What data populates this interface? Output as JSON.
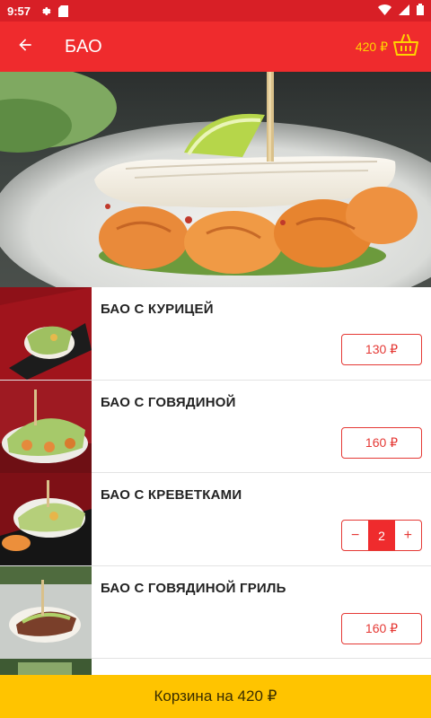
{
  "status_bar": {
    "time": "9:57",
    "icons": [
      "settings-icon",
      "sd-card-icon",
      "wifi-icon",
      "signal-icon",
      "battery-icon"
    ]
  },
  "app_bar": {
    "title": "БАО",
    "cart_total": "420 ₽",
    "back_icon": "arrow-back-icon",
    "cart_icon": "basket-icon"
  },
  "hero": {
    "image": "bao-with-shrimp-photo"
  },
  "items": [
    {
      "title": "БАО С КУРИЦЕЙ",
      "price": "130 ₽",
      "in_cart": false
    },
    {
      "title": "БАО С ГОВЯДИНОЙ",
      "price": "160 ₽",
      "in_cart": false
    },
    {
      "title": "БАО С КРЕВЕТКАМИ",
      "in_cart": true,
      "quantity": "2",
      "minus": "−",
      "plus": "+"
    },
    {
      "title": "БАО С ГОВЯДИНОЙ ГРИЛЬ",
      "price": "160 ₽",
      "in_cart": false
    }
  ],
  "bottom_bar": {
    "label": "Корзина на 420 ₽"
  },
  "colors": {
    "status_bar": "#d81f26",
    "app_bar": "#ef2b2d",
    "accent_red": "#e53935",
    "cart_total": "#ffd400",
    "bottom_bar": "#ffc400"
  }
}
